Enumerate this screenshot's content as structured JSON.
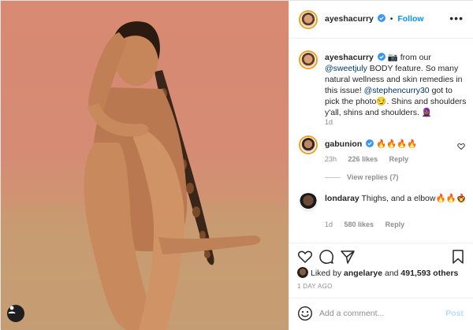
{
  "post": {
    "author": "ayeshacurry",
    "separator": "•",
    "follow_label": "Follow",
    "more_label": "•••"
  },
  "caption": {
    "username": "ayeshacurry",
    "prefix_emoji": "📷",
    "part1": " from our ",
    "mention1": "@sweetjuly",
    "part2": " BODY feature. So many natural wellness and skin remedies in this issue! ",
    "mention2": "@stephencurry30",
    "part3": " got to pick the photo😏. Shins and shoulders y'all, shins and shoulders. 🧕🏾",
    "age": "1d"
  },
  "comments": [
    {
      "username": "gabunion",
      "text": "🔥🔥🔥🔥",
      "age": "23h",
      "likes": "226 likes",
      "reply_label": "Reply",
      "view_replies": "View replies (7)"
    },
    {
      "username": "londaray",
      "text": "Thighs, and a elbow🔥🔥🔥",
      "age": "1d",
      "likes": "580 likes",
      "reply_label": "Reply"
    }
  ],
  "likes_summary": {
    "prefix": "Liked by ",
    "liker": "angelarye",
    "middle": " and ",
    "count": "491,593 others"
  },
  "timestamp": "1 DAY AGO",
  "add_comment": {
    "placeholder": "Add a comment...",
    "post_label": "Post"
  },
  "icons": {
    "like": "heart-icon",
    "comment": "comment-icon",
    "share": "paper-plane-icon",
    "save": "bookmark-icon",
    "emoji": "smiley-icon",
    "tags": "user-tag-icon",
    "verified": "verified-badge-icon"
  },
  "colors": {
    "link_blue": "#0095f6",
    "mention": "#00376b",
    "muted": "#8e8e8e",
    "post_disabled": "#b2dffc",
    "verified": "#3897f0",
    "backdrop": "#d88a72"
  }
}
